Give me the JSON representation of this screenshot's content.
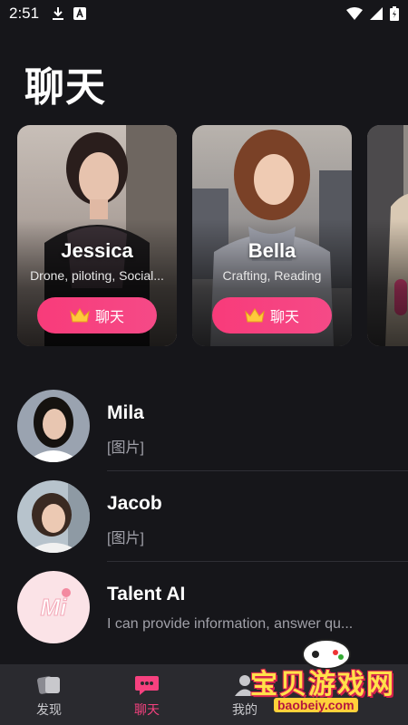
{
  "status": {
    "time": "2:51",
    "icons": [
      "download-icon",
      "a-notification-icon",
      "wifi-icon",
      "signal-icon",
      "battery-icon"
    ]
  },
  "header": {
    "title": "聊天"
  },
  "cards": [
    {
      "name": "Jessica",
      "tags": "Drone, piloting, Social...",
      "button": "聊天"
    },
    {
      "name": "Bella",
      "tags": "Crafting, Reading",
      "button": "聊天"
    }
  ],
  "chats": [
    {
      "name": "Mila",
      "preview": "[图片]"
    },
    {
      "name": "Jacob",
      "preview": "[图片]"
    },
    {
      "name": "Talent AI",
      "preview": "I can provide information, answer qu..."
    }
  ],
  "talent_logo": "Mi",
  "tabs": [
    {
      "label": "发现",
      "icon": "cards-icon",
      "active": false
    },
    {
      "label": "聊天",
      "icon": "chat-bubble-icon",
      "active": true
    },
    {
      "label": "我的",
      "icon": "user-icon",
      "active": false
    }
  ],
  "watermark": {
    "text": "宝贝游戏网",
    "url": "baobeiy.com"
  },
  "colors": {
    "accent": "#f6417f",
    "background": "#16161a",
    "tabbar": "#2a2a2f"
  }
}
